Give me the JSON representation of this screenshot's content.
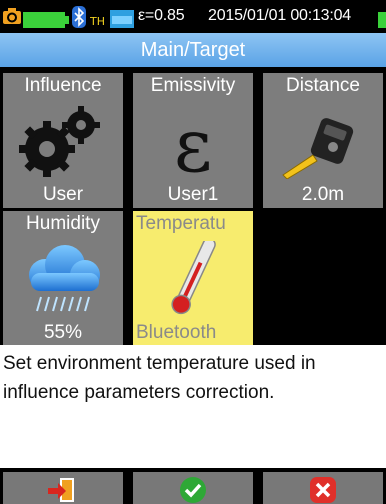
{
  "status": {
    "emissivity_text": "ε=0.85",
    "datetime": "2015/01/01 00:13:04",
    "icons": [
      "camera-mode-icon",
      "battery-icon",
      "bluetooth-icon",
      "thermo-hygrometer-icon",
      "sd-card-icon",
      "power-indicator-icon"
    ]
  },
  "header": {
    "title": "Main/Target"
  },
  "tiles": [
    {
      "label": "Influence",
      "value": "User",
      "icon": "gears-icon"
    },
    {
      "label": "Emissivity",
      "value": "User1",
      "icon": "epsilon-icon"
    },
    {
      "label": "Distance",
      "value": "2.0m",
      "icon": "tape-measure-icon"
    },
    {
      "label": "Humidity",
      "value": "55%",
      "icon": "rain-cloud-icon"
    },
    {
      "label": "Temperatu",
      "value": "Bluetooth",
      "icon": "thermometer-icon"
    }
  ],
  "description": "Set environment temperature used in influence parameters correction.",
  "footer": {
    "buttons": [
      "exit-icon",
      "confirm-icon",
      "cancel-icon"
    ]
  },
  "colors": {
    "title_bar": "#6cb0ec",
    "tile_bg": "#7d7d7d",
    "tile_selected_bg": "#f7ec6e",
    "confirm": "#2ea836",
    "cancel": "#e0302a",
    "exit": "#f0a020"
  }
}
